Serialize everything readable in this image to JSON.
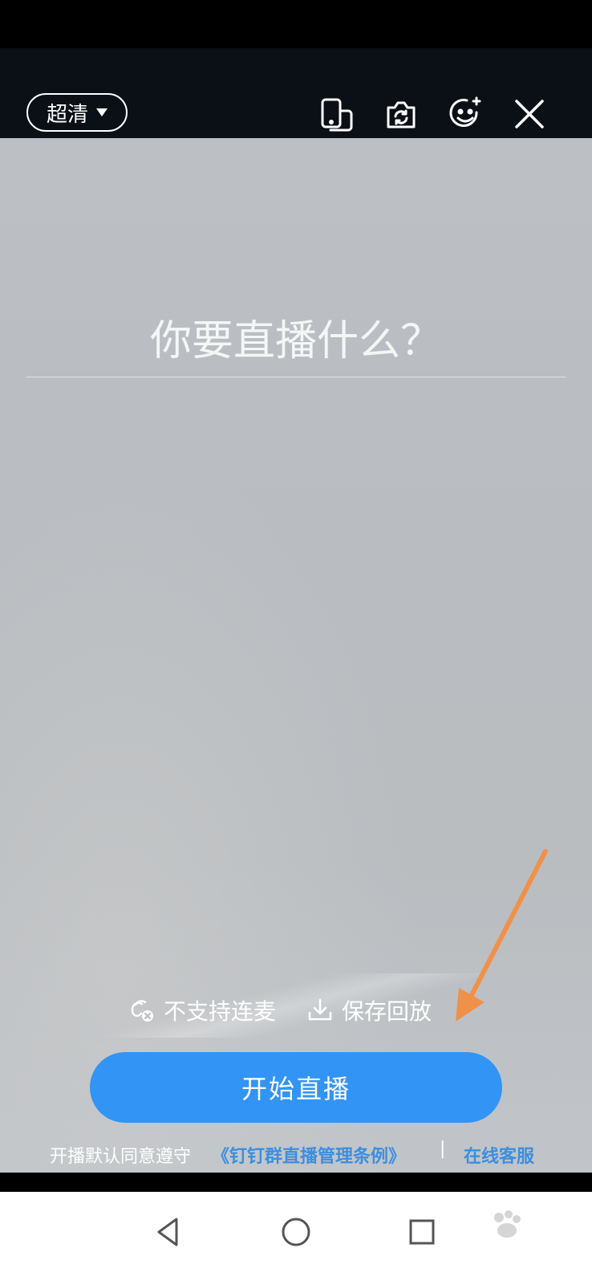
{
  "header": {
    "quality_label": "超清",
    "icons": [
      "switch-orientation-icon",
      "flip-camera-icon",
      "beauty-face-icon",
      "close-icon"
    ]
  },
  "main": {
    "title_placeholder": "你要直播什么？"
  },
  "options": {
    "no_connect_label": "不支持连麦",
    "save_replay_label": "保存回放"
  },
  "start_button_label": "开始直播",
  "footer": {
    "agree_text": "开播默认同意遵守",
    "rules_link": "《钉钉群直播管理条例》",
    "divider": "|",
    "service_link": "在线客服"
  },
  "colors": {
    "accent": "#3294f5",
    "link": "#3c8ee0",
    "annotation_arrow": "#f0914a"
  },
  "navigation": {
    "icons": [
      "back-icon",
      "home-icon",
      "recents-icon"
    ]
  }
}
